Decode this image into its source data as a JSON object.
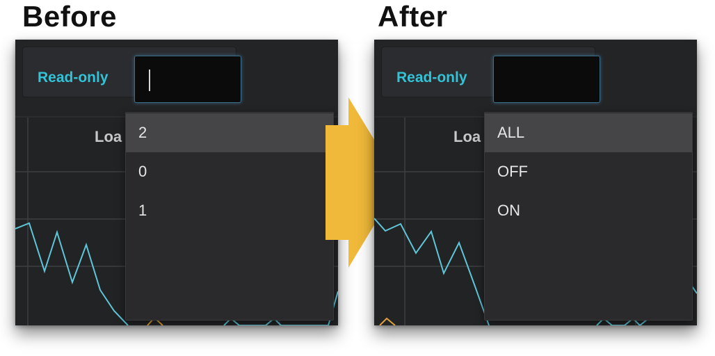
{
  "before": {
    "heading": "Before",
    "readonly_label": "Read-only",
    "input_value": "",
    "chart_title_partial": "Loa",
    "dropdown_items": [
      {
        "label": "2",
        "selected": true
      },
      {
        "label": "0",
        "selected": false
      },
      {
        "label": "1",
        "selected": false
      }
    ]
  },
  "after": {
    "heading": "After",
    "readonly_label": "Read-only",
    "input_value": "",
    "chart_title_partial": "Loa",
    "dropdown_items": [
      {
        "label": "ALL",
        "selected": true
      },
      {
        "label": "OFF",
        "selected": false
      },
      {
        "label": "ON",
        "selected": false
      }
    ]
  },
  "colors": {
    "accent_label": "#33c2d6",
    "arrow": "#f0b93a",
    "series_line": "#5fc6d8",
    "series_line_2": "#e0a13a",
    "panel_bg": "#2b2c2e",
    "dropdown_bg": "#2a2a2c",
    "selected_item_bg": "#454547"
  },
  "icons": {
    "transition_arrow": "right-arrow-icon"
  }
}
